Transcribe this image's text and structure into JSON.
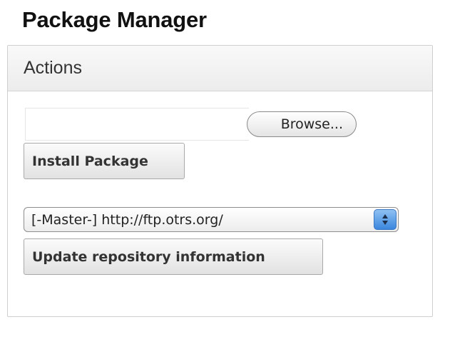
{
  "page": {
    "title": "Package Manager"
  },
  "actions": {
    "header": "Actions",
    "file_input": {
      "value": ""
    },
    "browse_label": "Browse...",
    "install_label": "Install Package",
    "repository_select": {
      "selected": "[-Master-] http://ftp.otrs.org/"
    },
    "update_label": "Update repository information"
  },
  "colors": {
    "select_arrow_accent": "#4a90e2",
    "panel_border": "#cfcfcf",
    "header_bg": "#f2f2f2"
  }
}
